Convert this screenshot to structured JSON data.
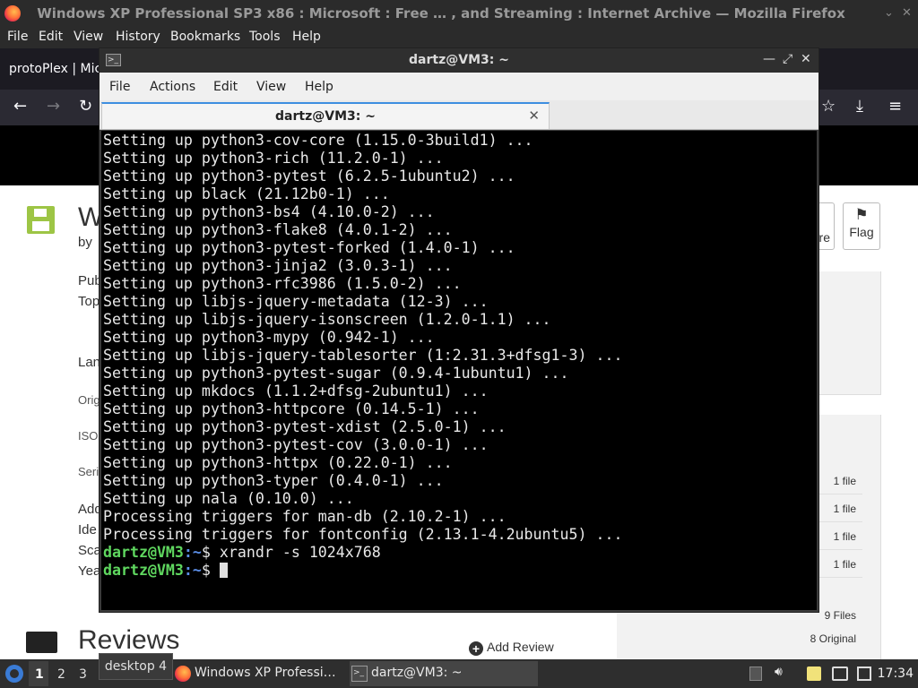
{
  "firefox": {
    "window_title": "Windows XP Professional SP3 x86 : Microsoft : Free …  , and Streaming : Internet Archive — Mozilla Firefox",
    "window_controls": {
      "minimize": "⌄",
      "close": "✕"
    },
    "menu": [
      "File",
      "Edit",
      "View",
      "History",
      "Bookmarks",
      "Tools",
      "Help"
    ],
    "tab_label": "protoPlex | Micr",
    "nav": {
      "back": "←",
      "forward": "→",
      "reload": "↻",
      "bookmark": "☆",
      "downloads": "⤓",
      "menu": "≡"
    }
  },
  "archive_page": {
    "title_fragment": "W",
    "by_fragment": "by",
    "meta_fragments": [
      "Pub",
      "Top",
      "Lan",
      "Orig",
      "ISO",
      "Seri",
      "Add",
      "Ide",
      "Sca",
      "Yea"
    ],
    "share_label": "re",
    "flag_label": "Flag",
    "flag_icon": "⚑",
    "file_rows": [
      "1 file",
      "1 file",
      "1 file",
      "1 file"
    ],
    "total_files": "9 Files",
    "total_original": "8 Original",
    "reviews_title": "Reviews",
    "add_review": "Add Review",
    "add_review_icon": "+"
  },
  "terminal": {
    "window_title": "dartz@VM3: ~",
    "window_controls": {
      "minimize": "—",
      "maximize": "⤢",
      "close": "✕"
    },
    "menu": [
      "File",
      "Actions",
      "Edit",
      "View",
      "Help"
    ],
    "tab_title": "dartz@VM3: ~",
    "tab_close": "✕",
    "output_lines": [
      "Setting up python3-cov-core (1.15.0-3build1) ...",
      "Setting up python3-rich (11.2.0-1) ...",
      "Setting up python3-pytest (6.2.5-1ubuntu2) ...",
      "Setting up black (21.12b0-1) ...",
      "Setting up python3-bs4 (4.10.0-2) ...",
      "Setting up python3-flake8 (4.0.1-2) ...",
      "Setting up python3-pytest-forked (1.4.0-1) ...",
      "Setting up python3-jinja2 (3.0.3-1) ...",
      "Setting up python3-rfc3986 (1.5.0-2) ...",
      "Setting up libjs-jquery-metadata (12-3) ...",
      "Setting up libjs-jquery-isonscreen (1.2.0-1.1) ...",
      "Setting up python3-mypy (0.942-1) ...",
      "Setting up libjs-jquery-tablesorter (1:2.31.3+dfsg1-3) ...",
      "Setting up python3-pytest-sugar (0.9.4-1ubuntu1) ...",
      "Setting up mkdocs (1.1.2+dfsg-2ubuntu1) ...",
      "Setting up python3-httpcore (0.14.5-1) ...",
      "Setting up python3-pytest-xdist (2.5.0-1) ...",
      "Setting up python3-pytest-cov (3.0.0-1) ...",
      "Setting up python3-httpx (0.22.0-1) ...",
      "Setting up python3-typer (0.4.0-1) ...",
      "Setting up nala (0.10.0) ...",
      "Processing triggers for man-db (2.10.2-1) ...",
      "Processing triggers for fontconfig (2.13.1-4.2ubuntu5) ..."
    ],
    "prompts": [
      {
        "user": "dartz@VM3",
        "sep": ":",
        "path": "~",
        "symbol": "$",
        "command": " xrandr -s 1024x768"
      },
      {
        "user": "dartz@VM3",
        "sep": ":",
        "path": "~",
        "symbol": "$",
        "command": " "
      }
    ]
  },
  "taskbar": {
    "workspaces": [
      "1",
      "2",
      "3"
    ],
    "tooltip": "desktop 4",
    "tasks": [
      {
        "label": "Windows XP Professi…",
        "icon": "firefox-icon"
      },
      {
        "label": "dartz@VM3: ~",
        "icon": "terminal-icon"
      }
    ],
    "clock": "17:34"
  }
}
